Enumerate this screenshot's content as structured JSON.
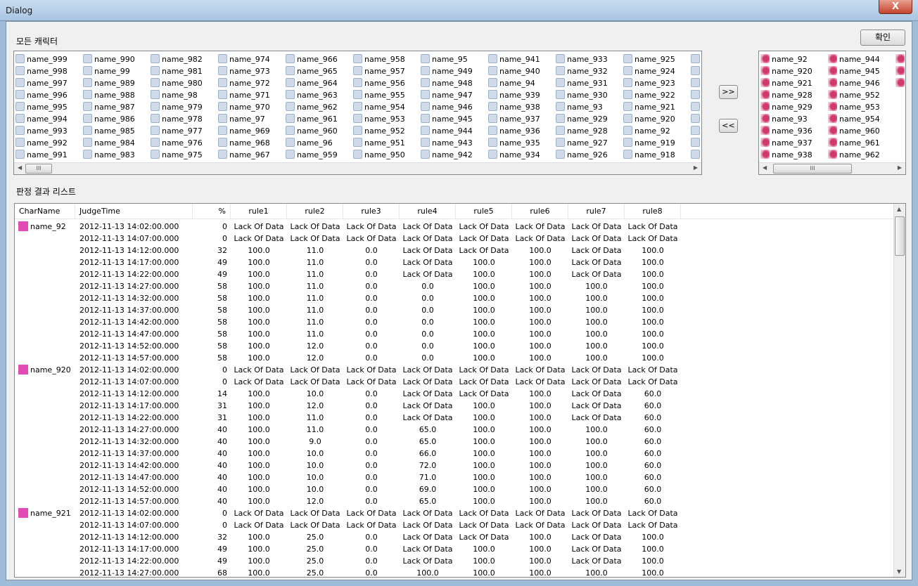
{
  "window": {
    "title": "Dialog",
    "close_label": "X"
  },
  "top": {
    "all_label": "모든 캐릭터",
    "ok_label": "확인",
    "add_label": ">>",
    "remove_label": "<<"
  },
  "all_characters": [
    [
      "name_999",
      "name_998",
      "name_997",
      "name_996",
      "name_995",
      "name_994",
      "name_993",
      "name_992",
      "name_991"
    ],
    [
      "name_990",
      "name_99",
      "name_989",
      "name_988",
      "name_987",
      "name_986",
      "name_985",
      "name_984",
      "name_983"
    ],
    [
      "name_982",
      "name_981",
      "name_980",
      "name_98",
      "name_979",
      "name_978",
      "name_977",
      "name_976",
      "name_975"
    ],
    [
      "name_974",
      "name_973",
      "name_972",
      "name_971",
      "name_970",
      "name_97",
      "name_969",
      "name_968",
      "name_967"
    ],
    [
      "name_966",
      "name_965",
      "name_964",
      "name_963",
      "name_962",
      "name_961",
      "name_960",
      "name_96",
      "name_959"
    ],
    [
      "name_958",
      "name_957",
      "name_956",
      "name_955",
      "name_954",
      "name_953",
      "name_952",
      "name_951",
      "name_950"
    ],
    [
      "name_95",
      "name_949",
      "name_948",
      "name_947",
      "name_946",
      "name_945",
      "name_944",
      "name_943",
      "name_942"
    ],
    [
      "name_941",
      "name_940",
      "name_94",
      "name_939",
      "name_938",
      "name_937",
      "name_936",
      "name_935",
      "name_934"
    ],
    [
      "name_933",
      "name_932",
      "name_931",
      "name_930",
      "name_93",
      "name_929",
      "name_928",
      "name_927",
      "name_926"
    ],
    [
      "name_925",
      "name_924",
      "name_923",
      "name_922",
      "name_921",
      "name_920",
      "name_92",
      "name_919",
      "name_918"
    ]
  ],
  "selected_characters": [
    [
      "name_92",
      "name_920",
      "name_921",
      "name_928",
      "name_929",
      "name_93",
      "name_936",
      "name_937",
      "name_938"
    ],
    [
      "name_944",
      "name_945",
      "name_946",
      "name_952",
      "name_953",
      "name_954",
      "name_960",
      "name_961",
      "name_962"
    ]
  ],
  "results": {
    "label": "판정 결과 리스트",
    "columns": [
      "CharName",
      "JudgeTime",
      "%",
      "rule1",
      "rule2",
      "rule3",
      "rule4",
      "rule5",
      "rule6",
      "rule7",
      "rule8"
    ],
    "groups": [
      {
        "char": "name_92",
        "rows": [
          [
            "2012-11-13 14:02:00.000",
            "0",
            "Lack Of Data",
            "Lack Of Data",
            "Lack Of Data",
            "Lack Of Data",
            "Lack Of Data",
            "Lack Of Data",
            "Lack Of Data",
            "Lack Of Data"
          ],
          [
            "2012-11-13 14:07:00.000",
            "0",
            "Lack Of Data",
            "Lack Of Data",
            "Lack Of Data",
            "Lack Of Data",
            "Lack Of Data",
            "Lack Of Data",
            "Lack Of Data",
            "Lack Of Data"
          ],
          [
            "2012-11-13 14:12:00.000",
            "32",
            "100.0",
            "11.0",
            "0.0",
            "Lack Of Data",
            "Lack Of Data",
            "100.0",
            "Lack Of Data",
            "100.0"
          ],
          [
            "2012-11-13 14:17:00.000",
            "49",
            "100.0",
            "11.0",
            "0.0",
            "Lack Of Data",
            "100.0",
            "100.0",
            "Lack Of Data",
            "100.0"
          ],
          [
            "2012-11-13 14:22:00.000",
            "49",
            "100.0",
            "11.0",
            "0.0",
            "Lack Of Data",
            "100.0",
            "100.0",
            "Lack Of Data",
            "100.0"
          ],
          [
            "2012-11-13 14:27:00.000",
            "58",
            "100.0",
            "11.0",
            "0.0",
            "0.0",
            "100.0",
            "100.0",
            "100.0",
            "100.0"
          ],
          [
            "2012-11-13 14:32:00.000",
            "58",
            "100.0",
            "11.0",
            "0.0",
            "0.0",
            "100.0",
            "100.0",
            "100.0",
            "100.0"
          ],
          [
            "2012-11-13 14:37:00.000",
            "58",
            "100.0",
            "11.0",
            "0.0",
            "0.0",
            "100.0",
            "100.0",
            "100.0",
            "100.0"
          ],
          [
            "2012-11-13 14:42:00.000",
            "58",
            "100.0",
            "11.0",
            "0.0",
            "0.0",
            "100.0",
            "100.0",
            "100.0",
            "100.0"
          ],
          [
            "2012-11-13 14:47:00.000",
            "58",
            "100.0",
            "11.0",
            "0.0",
            "0.0",
            "100.0",
            "100.0",
            "100.0",
            "100.0"
          ],
          [
            "2012-11-13 14:52:00.000",
            "58",
            "100.0",
            "12.0",
            "0.0",
            "0.0",
            "100.0",
            "100.0",
            "100.0",
            "100.0"
          ],
          [
            "2012-11-13 14:57:00.000",
            "58",
            "100.0",
            "12.0",
            "0.0",
            "0.0",
            "100.0",
            "100.0",
            "100.0",
            "100.0"
          ]
        ]
      },
      {
        "char": "name_920",
        "rows": [
          [
            "2012-11-13 14:02:00.000",
            "0",
            "Lack Of Data",
            "Lack Of Data",
            "Lack Of Data",
            "Lack Of Data",
            "Lack Of Data",
            "Lack Of Data",
            "Lack Of Data",
            "Lack Of Data"
          ],
          [
            "2012-11-13 14:07:00.000",
            "0",
            "Lack Of Data",
            "Lack Of Data",
            "Lack Of Data",
            "Lack Of Data",
            "Lack Of Data",
            "Lack Of Data",
            "Lack Of Data",
            "Lack Of Data"
          ],
          [
            "2012-11-13 14:12:00.000",
            "14",
            "100.0",
            "10.0",
            "0.0",
            "Lack Of Data",
            "Lack Of Data",
            "100.0",
            "Lack Of Data",
            "60.0"
          ],
          [
            "2012-11-13 14:17:00.000",
            "31",
            "100.0",
            "12.0",
            "0.0",
            "Lack Of Data",
            "100.0",
            "100.0",
            "Lack Of Data",
            "60.0"
          ],
          [
            "2012-11-13 14:22:00.000",
            "31",
            "100.0",
            "11.0",
            "0.0",
            "Lack Of Data",
            "100.0",
            "100.0",
            "Lack Of Data",
            "60.0"
          ],
          [
            "2012-11-13 14:27:00.000",
            "40",
            "100.0",
            "11.0",
            "0.0",
            "65.0",
            "100.0",
            "100.0",
            "100.0",
            "60.0"
          ],
          [
            "2012-11-13 14:32:00.000",
            "40",
            "100.0",
            "9.0",
            "0.0",
            "65.0",
            "100.0",
            "100.0",
            "100.0",
            "60.0"
          ],
          [
            "2012-11-13 14:37:00.000",
            "40",
            "100.0",
            "10.0",
            "0.0",
            "66.0",
            "100.0",
            "100.0",
            "100.0",
            "60.0"
          ],
          [
            "2012-11-13 14:42:00.000",
            "40",
            "100.0",
            "10.0",
            "0.0",
            "72.0",
            "100.0",
            "100.0",
            "100.0",
            "60.0"
          ],
          [
            "2012-11-13 14:47:00.000",
            "40",
            "100.0",
            "10.0",
            "0.0",
            "71.0",
            "100.0",
            "100.0",
            "100.0",
            "60.0"
          ],
          [
            "2012-11-13 14:52:00.000",
            "40",
            "100.0",
            "10.0",
            "0.0",
            "69.0",
            "100.0",
            "100.0",
            "100.0",
            "60.0"
          ],
          [
            "2012-11-13 14:57:00.000",
            "40",
            "100.0",
            "12.0",
            "0.0",
            "65.0",
            "100.0",
            "100.0",
            "100.0",
            "60.0"
          ]
        ]
      },
      {
        "char": "name_921",
        "rows": [
          [
            "2012-11-13 14:02:00.000",
            "0",
            "Lack Of Data",
            "Lack Of Data",
            "Lack Of Data",
            "Lack Of Data",
            "Lack Of Data",
            "Lack Of Data",
            "Lack Of Data",
            "Lack Of Data"
          ],
          [
            "2012-11-13 14:07:00.000",
            "0",
            "Lack Of Data",
            "Lack Of Data",
            "Lack Of Data",
            "Lack Of Data",
            "Lack Of Data",
            "Lack Of Data",
            "Lack Of Data",
            "Lack Of Data"
          ],
          [
            "2012-11-13 14:12:00.000",
            "32",
            "100.0",
            "25.0",
            "0.0",
            "Lack Of Data",
            "Lack Of Data",
            "100.0",
            "Lack Of Data",
            "100.0"
          ],
          [
            "2012-11-13 14:17:00.000",
            "49",
            "100.0",
            "25.0",
            "0.0",
            "Lack Of Data",
            "100.0",
            "100.0",
            "Lack Of Data",
            "100.0"
          ],
          [
            "2012-11-13 14:22:00.000",
            "49",
            "100.0",
            "25.0",
            "0.0",
            "Lack Of Data",
            "100.0",
            "100.0",
            "Lack Of Data",
            "100.0"
          ],
          [
            "2012-11-13 14:27:00.000",
            "68",
            "100.0",
            "25.0",
            "0.0",
            "100.0",
            "100.0",
            "100.0",
            "100.0",
            "100.0"
          ]
        ]
      }
    ]
  }
}
